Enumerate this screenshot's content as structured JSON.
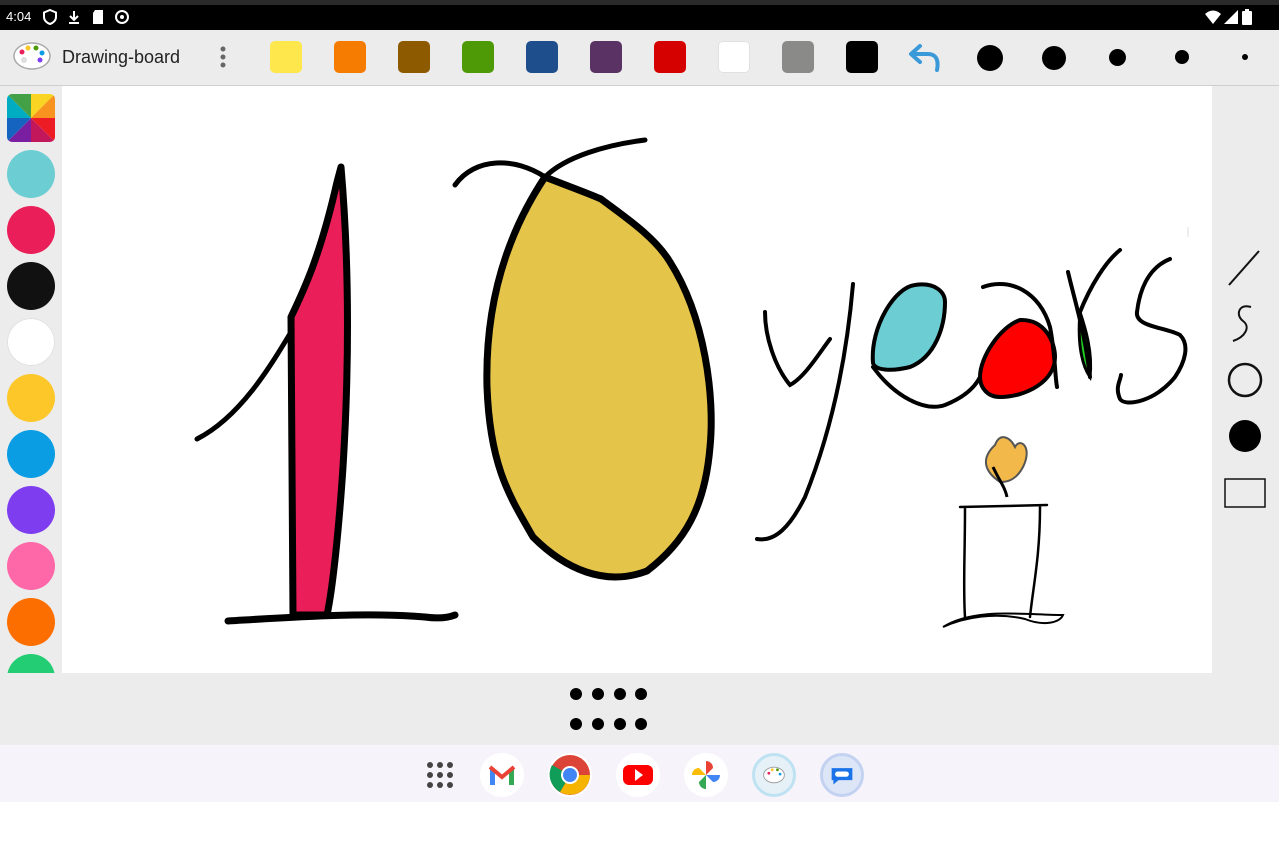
{
  "status_bar": {
    "time": "4:04",
    "left_icons": [
      "shield-icon",
      "download-icon",
      "sd-card-icon",
      "sync-icon"
    ],
    "right_icons": [
      "wifi-icon",
      "signal-icon",
      "battery-icon"
    ]
  },
  "toolbar": {
    "app_title": "Drawing-board",
    "menu_icon": "more-vert-icon",
    "colors": [
      "#fde74c",
      "#f57c00",
      "#8d5a00",
      "#4e9a06",
      "#1f4e8c",
      "#5b3264",
      "#d50000",
      "#ffffff",
      "#8a8a88",
      "#000000"
    ],
    "undo_icon": "undo-icon",
    "brush_sizes": [
      "xlarge",
      "large",
      "medium",
      "small",
      "tiny"
    ]
  },
  "palette": {
    "colors": [
      "#6ccdd2",
      "#ea1e58",
      "#111111",
      "#ffffff",
      "#fdc72a",
      "#0a9de3",
      "#7e3ef0",
      "#fe68a8",
      "#fd6e00",
      "#22cd73"
    ]
  },
  "canvas": {
    "drawing_colors": {
      "one_fill": "#ea1e58",
      "zero_fill": "#e5c44a",
      "e_fill": "#6ccdd2",
      "a_fill": "#ff0000",
      "r_fill": "#22cc22",
      "flame_fill": "#f2b84a",
      "stroke": "#000000"
    }
  },
  "tools": [
    "line-tool-icon",
    "freehand-tool-icon",
    "circle-outline-tool-icon",
    "filled-circle-tool-icon",
    "rectangle-tool-icon"
  ],
  "dock": {
    "apps": [
      "app-drawer-icon",
      "gmail-icon",
      "chrome-icon",
      "youtube-icon",
      "photos-icon",
      "drawing-board-icon",
      "messages-icon"
    ]
  }
}
